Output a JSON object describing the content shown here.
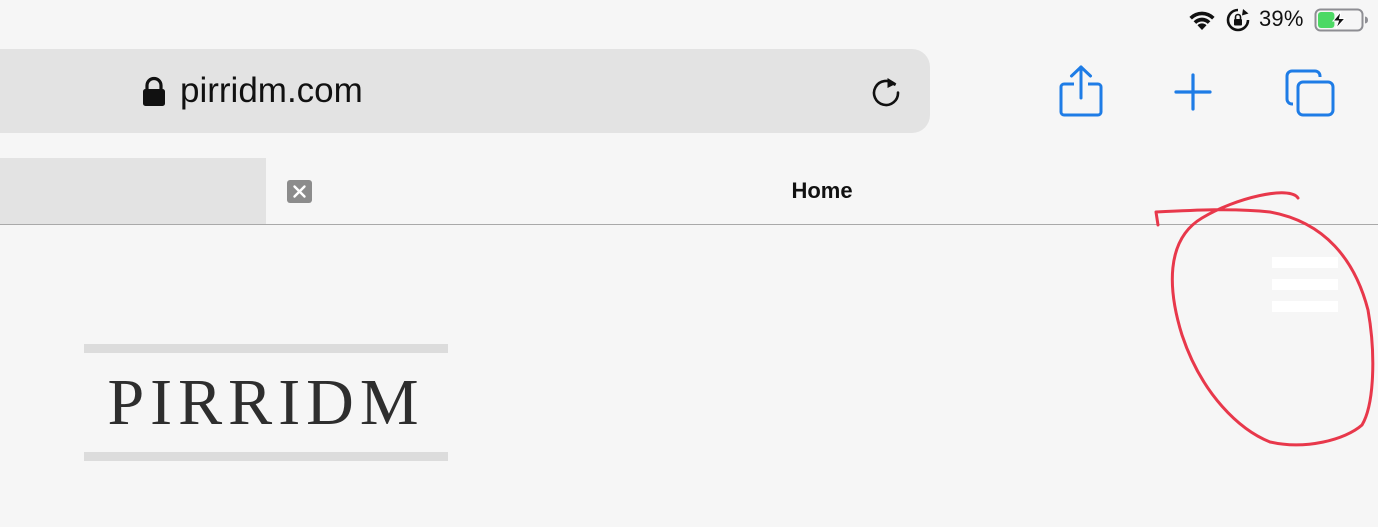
{
  "status_bar": {
    "battery_percent": "39%",
    "battery_level": 0.39,
    "charging": true,
    "icons": [
      "wifi-icon",
      "rotation-lock-icon",
      "battery-icon"
    ]
  },
  "browser": {
    "url": "pirridm.com",
    "tab_title": "Home",
    "accent_color": "#1e7ce6",
    "icons": [
      "lock-icon",
      "reload-icon",
      "share-icon",
      "plus-icon",
      "tabs-icon",
      "close-icon"
    ]
  },
  "page": {
    "logo_text": "PIRRIDM",
    "icons": [
      "hamburger-menu-icon"
    ],
    "annotation_color": "#e8384b"
  }
}
